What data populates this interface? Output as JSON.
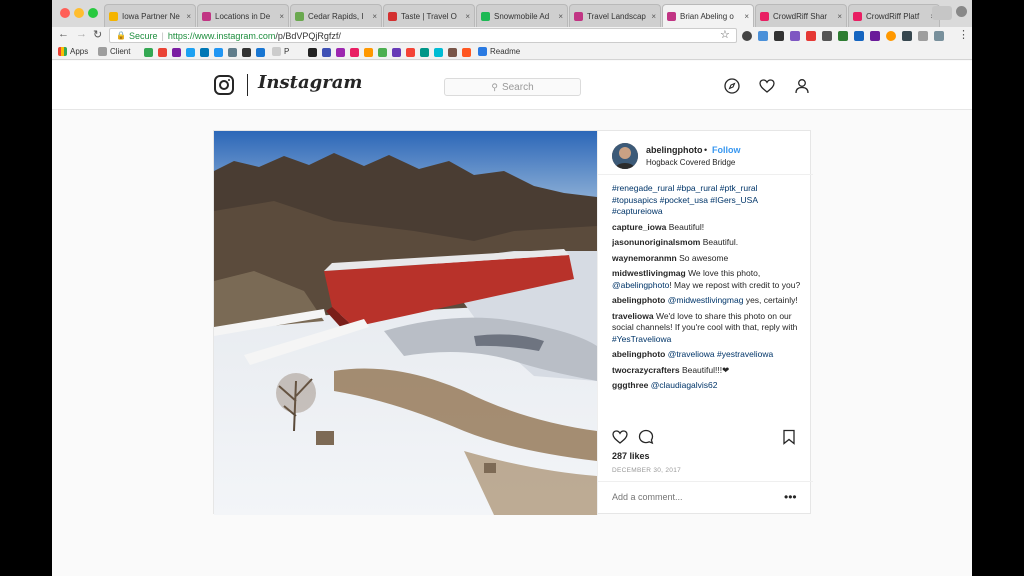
{
  "browser": {
    "tabs": [
      {
        "label": "Iowa Partner Ne",
        "color": "#f4b400"
      },
      {
        "label": "Locations in De",
        "color": "#c13584"
      },
      {
        "label": "Cedar Rapids, I",
        "color": "#6aa84f"
      },
      {
        "label": "Taste | Travel O",
        "color": "#d32f2f"
      },
      {
        "label": "Snowmobile Ad",
        "color": "#1db954"
      },
      {
        "label": "Travel Landscap",
        "color": "#c13584"
      },
      {
        "label": "Brian Abeling o",
        "color": "#c13584"
      },
      {
        "label": "CrowdRiff Shar",
        "color": "#e91e63"
      },
      {
        "label": "CrowdRiff Platf",
        "color": "#e91e63"
      }
    ],
    "secure_label": "Secure",
    "url_host": "https://www.instagram.com",
    "url_path": "/p/BdVPQjRgfzf/",
    "bookmarks": [
      {
        "label": "Apps",
        "color": "#888888"
      },
      {
        "label": "Client",
        "color": "#9e9e9e"
      },
      {
        "label": "P",
        "color": "#555555"
      },
      {
        "label": "Readme",
        "color": "#2a7ae2"
      }
    ]
  },
  "instagram": {
    "wordmark": "Instagram",
    "search_placeholder": "Search",
    "icons": [
      "explore-icon",
      "heart-icon",
      "profile-icon"
    ]
  },
  "post": {
    "username": "abelingphoto",
    "follow_label": "Follow",
    "dot": "•",
    "location": "Hogback Covered Bridge",
    "hashtags": [
      "#renegade_rural #bpa_rural #ptk_rural",
      "#topusapics #pocket_usa #IGers_USA",
      "#captureiowa"
    ],
    "comments": [
      {
        "user": "capture_iowa",
        "text": "Beautiful!"
      },
      {
        "user": "jasonunoriginalsmom",
        "text": "Beautiful."
      },
      {
        "user": "waynemoranmn",
        "text": "So awesome"
      },
      {
        "user": "midwestlivingmag",
        "text": "We love this photo,",
        "mention": "@abelingphoto",
        "text2": "! May we repost with credit to you?"
      },
      {
        "user": "abelingphoto",
        "mention": "@midwestlivingmag",
        "text2": " yes, certainly!"
      },
      {
        "user": "traveliowa",
        "text": "We'd love to share this photo on our social channels! If you're cool with that, reply with",
        "mention": "#YesTraveliowa"
      },
      {
        "user": "abelingphoto",
        "mention": "@traveliowa #yestraveliowa"
      },
      {
        "user": "twocrazycrafters",
        "text": "Beautiful!!!❤"
      },
      {
        "user": "gggthree",
        "mention": "@claudiagalvis62"
      }
    ],
    "likes": "287 likes",
    "date": "DECEMBER 30, 2017",
    "add_comment_placeholder": "Add a comment...",
    "more": "•••"
  }
}
